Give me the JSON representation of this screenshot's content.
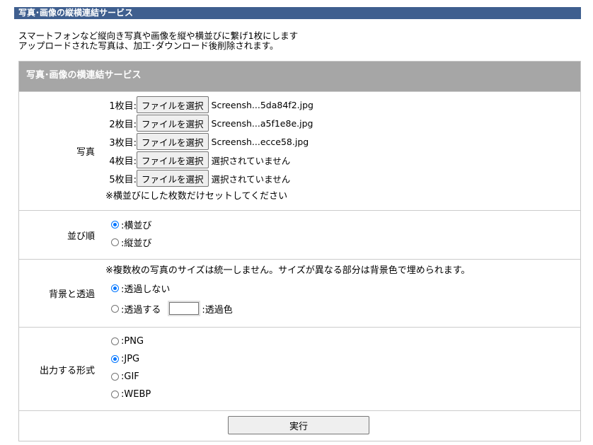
{
  "top_title": "写真･画像の縦横連結サービス",
  "description": {
    "line1": "スマートフォンなど縦向き写真や画像を縦や横並びに繋げ1枚にします",
    "line2": "アップロードされた写真は、加工･ダウンロード後削除されます。"
  },
  "panel_title": "写真･画像の横連結サービス",
  "photos": {
    "label": "写真",
    "button_label": "ファイルを選択",
    "files": [
      {
        "num": "1枚目:",
        "name": "Screensh...5da84f2.jpg"
      },
      {
        "num": "2枚目:",
        "name": "Screensh...a5f1e8e.jpg"
      },
      {
        "num": "3枚目:",
        "name": "Screensh...ecce58.jpg"
      },
      {
        "num": "4枚目:",
        "name": "選択されていません"
      },
      {
        "num": "5枚目:",
        "name": "選択されていません"
      }
    ],
    "note": "※横並びにした枚数だけセットしてください"
  },
  "order": {
    "label": "並び順",
    "options": [
      {
        "label": ":横並び",
        "checked": true
      },
      {
        "label": ":縦並び",
        "checked": false
      }
    ]
  },
  "background": {
    "label": "背景と透過",
    "note": "※複数枚の写真のサイズは統一しません。サイズが異なる部分は背景色で埋められます。",
    "options": [
      {
        "label": ":透過しない",
        "checked": true
      },
      {
        "label": ":透過する",
        "checked": false
      }
    ],
    "color_label": ":透過色"
  },
  "format": {
    "label": "出力する形式",
    "options": [
      {
        "label": ":PNG",
        "checked": false
      },
      {
        "label": ":JPG",
        "checked": true
      },
      {
        "label": ":GIF",
        "checked": false
      },
      {
        "label": ":WEBP",
        "checked": false
      }
    ]
  },
  "submit_label": "実行"
}
